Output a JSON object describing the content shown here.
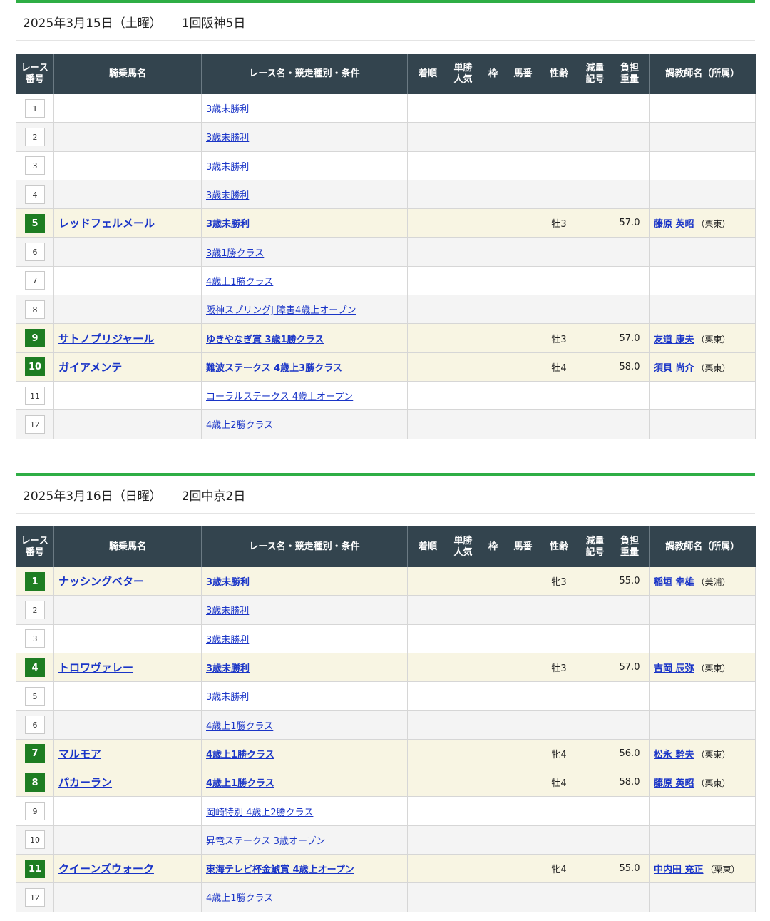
{
  "headers": [
    "レース\n番号",
    "騎乗馬名",
    "レース名・競走種別・条件",
    "着順",
    "単勝\n人気",
    "枠",
    "馬番",
    "性齢",
    "減量\n記号",
    "負担\n重量",
    "調教師名（所属）"
  ],
  "days": [
    {
      "date": "2025年3月15日（土曜）",
      "venue": "1回阪神5日",
      "races": [
        {
          "no": "1",
          "race": "3歳未勝利",
          "horse": "",
          "sexage": "",
          "weight": "",
          "trainer": "",
          "aff": ""
        },
        {
          "no": "2",
          "race": "3歳未勝利",
          "horse": "",
          "sexage": "",
          "weight": "",
          "trainer": "",
          "aff": ""
        },
        {
          "no": "3",
          "race": "3歳未勝利",
          "horse": "",
          "sexage": "",
          "weight": "",
          "trainer": "",
          "aff": ""
        },
        {
          "no": "4",
          "race": "3歳未勝利",
          "horse": "",
          "sexage": "",
          "weight": "",
          "trainer": "",
          "aff": ""
        },
        {
          "no": "5",
          "race": "3歳未勝利",
          "horse": "レッドフェルメール",
          "sexage": "牡3",
          "weight": "57.0",
          "trainer": "藤原 英昭",
          "aff": "（栗東）"
        },
        {
          "no": "6",
          "race": "3歳1勝クラス",
          "horse": "",
          "sexage": "",
          "weight": "",
          "trainer": "",
          "aff": ""
        },
        {
          "no": "7",
          "race": "4歳上1勝クラス",
          "horse": "",
          "sexage": "",
          "weight": "",
          "trainer": "",
          "aff": ""
        },
        {
          "no": "8",
          "race": "阪神スプリングJ 障害4歳上オープン",
          "horse": "",
          "sexage": "",
          "weight": "",
          "trainer": "",
          "aff": ""
        },
        {
          "no": "9",
          "race": "ゆきやなぎ賞 3歳1勝クラス",
          "horse": "サトノプリジャール",
          "sexage": "牡3",
          "weight": "57.0",
          "trainer": "友道 康夫",
          "aff": "（栗東）"
        },
        {
          "no": "10",
          "race": "難波ステークス 4歳上3勝クラス",
          "horse": "ガイアメンテ",
          "sexage": "牡4",
          "weight": "58.0",
          "trainer": "須貝 尚介",
          "aff": "（栗東）"
        },
        {
          "no": "11",
          "race": "コーラルステークス 4歳上オープン",
          "horse": "",
          "sexage": "",
          "weight": "",
          "trainer": "",
          "aff": ""
        },
        {
          "no": "12",
          "race": "4歳上2勝クラス",
          "horse": "",
          "sexage": "",
          "weight": "",
          "trainer": "",
          "aff": ""
        }
      ]
    },
    {
      "date": "2025年3月16日（日曜）",
      "venue": "2回中京2日",
      "races": [
        {
          "no": "1",
          "race": "3歳未勝利",
          "horse": "ナッシングベター",
          "sexage": "牝3",
          "weight": "55.0",
          "trainer": "稲垣 幸雄",
          "aff": "（美浦）"
        },
        {
          "no": "2",
          "race": "3歳未勝利",
          "horse": "",
          "sexage": "",
          "weight": "",
          "trainer": "",
          "aff": ""
        },
        {
          "no": "3",
          "race": "3歳未勝利",
          "horse": "",
          "sexage": "",
          "weight": "",
          "trainer": "",
          "aff": ""
        },
        {
          "no": "4",
          "race": "3歳未勝利",
          "horse": "トロワヴァレー",
          "sexage": "牡3",
          "weight": "57.0",
          "trainer": "吉岡 辰弥",
          "aff": "（栗東）"
        },
        {
          "no": "5",
          "race": "3歳未勝利",
          "horse": "",
          "sexage": "",
          "weight": "",
          "trainer": "",
          "aff": ""
        },
        {
          "no": "6",
          "race": "4歳上1勝クラス",
          "horse": "",
          "sexage": "",
          "weight": "",
          "trainer": "",
          "aff": ""
        },
        {
          "no": "7",
          "race": "4歳上1勝クラス",
          "horse": "マルモア",
          "sexage": "牝4",
          "weight": "56.0",
          "trainer": "松永 幹夫",
          "aff": "（栗東）"
        },
        {
          "no": "8",
          "race": "4歳上1勝クラス",
          "horse": "パカーラン",
          "sexage": "牡4",
          "weight": "58.0",
          "trainer": "藤原 英昭",
          "aff": "（栗東）"
        },
        {
          "no": "9",
          "race": "岡崎特別 4歳上2勝クラス",
          "horse": "",
          "sexage": "",
          "weight": "",
          "trainer": "",
          "aff": ""
        },
        {
          "no": "10",
          "race": "昇竜ステークス 3歳オープン",
          "horse": "",
          "sexage": "",
          "weight": "",
          "trainer": "",
          "aff": ""
        },
        {
          "no": "11",
          "race": "東海テレビ杯金鯱賞 4歳上オープン",
          "horse": "クイーンズウォーク",
          "sexage": "牝4",
          "weight": "55.0",
          "trainer": "中内田 充正",
          "aff": "（栗東）"
        },
        {
          "no": "12",
          "race": "4歳上1勝クラス",
          "horse": "",
          "sexage": "",
          "weight": "",
          "trainer": "",
          "aff": ""
        }
      ]
    }
  ]
}
